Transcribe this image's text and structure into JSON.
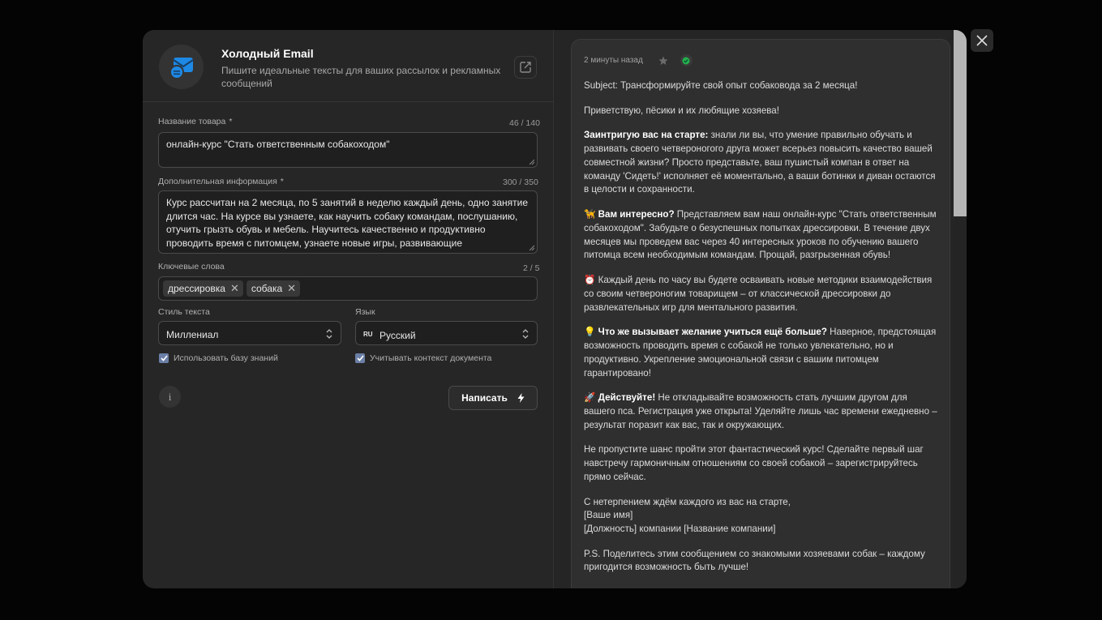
{
  "app": {
    "title": "Холодный Email",
    "subtitle": "Пишите идеальные тексты для ваших рассылок и рекламных сообщений"
  },
  "form": {
    "product": {
      "label": "Название товара",
      "required": "*",
      "counter": "46 / 140",
      "value": "онлайн-курс \"Стать ответственным собакоходом\""
    },
    "info": {
      "label": "Дополнительная информация",
      "required": "*",
      "counter": "300 / 350",
      "value": "Курс рассчитан на 2 месяца, по 5 занятий в неделю каждый день, одно занятие длится час. На курсе вы узнаете, как научить собаку командам, послушанию, отучить грызть обувь и мебель. Научитесь качественно и продуктивно проводить время с питомцем, узнаете новые игры, развивающие мыслительные"
    },
    "keywords": {
      "label": "Ключевые слова",
      "counter": "2 / 5",
      "tags": [
        "дрессировка",
        "собака"
      ]
    },
    "style": {
      "label": "Стиль текста",
      "value": "Миллениал"
    },
    "language": {
      "label": "Язык",
      "code": "RU",
      "value": "Русский"
    },
    "use_kb": {
      "label": "Использовать базу знаний",
      "checked": true
    },
    "use_context": {
      "label": "Учитывать контекст документа",
      "checked": true
    },
    "info_icon": "i",
    "submit_label": "Написать"
  },
  "result": {
    "time": "2 минуты назад",
    "subject": "Subject: Трансформируйте свой опыт собаковода за 2 месяца!",
    "greeting": "Приветствую, пёсики и их любящие хозяева!",
    "p1_bold": "Заинтригую вас на старте:",
    "p1": " знали ли вы, что умение правильно обучать и развивать своего четвероногого друга может всерьез повысить качество вашей совместной жизни? Просто представьте, ваш пушистый компан в ответ на команду 'Сидеть!' исполняет её моментально, а ваши ботинки и диван остаются в целости и сохранности.",
    "p2_emoji": "🦮",
    "p2_bold": "Вам интересно?",
    "p2": " Представляем вам наш онлайн-курс \"Стать ответственным собакоходом\". Забудьте о безуспешных попытках дрессировки. В течение двух месяцев мы проведем вас через 40 интересных уроков по обучению вашего питомца всем необходимым командам. Прощай, разгрызенная обувь!",
    "p3_emoji": "⏰",
    "p3": " Каждый день по часу вы будете осваивать новые методики взаимодействия со своим четвероногим товарищем – от классической дрессировки до развлекательных игр для ментального развития.",
    "p4_emoji": "💡",
    "p4_bold": "Что же вызывает желание учиться ещё больше?",
    "p4": " Наверное, предстоящая возможность проводить время с собакой не только увлекательно, но и продуктивно. Укрепление эмоциональной связи с вашим питомцем гарантировано!",
    "p5_emoji": "🚀",
    "p5_bold": "Действуйте!",
    "p5": " Не откладывайте возможность стать лучшим другом для вашего пса. Регистрация уже открыта! Уделяйте лишь час времени ежедневно – результат поразит как вас, так и окружающих.",
    "p6": "Не пропустите шанс пройти этот фантастический курс! Сделайте первый шаг навстречу гармоничным отношениям со своей собакой – зарегистрируйтесь прямо сейчас.",
    "sign1": "С нетерпением ждём каждого из вас на старте,",
    "sign2": "[Ваше имя]",
    "sign3": "[Должность] компании [Название компании]",
    "ps": "P.S. Поделитесь этим сообщением со знакомыми хозяевами собак – каждому пригодится возможность быть лучше!"
  },
  "colors": {
    "modal_bg": "#262626",
    "card_bg": "#2f2f2f",
    "accent_blue": "#1e88e5",
    "check_green": "#22b14c"
  }
}
